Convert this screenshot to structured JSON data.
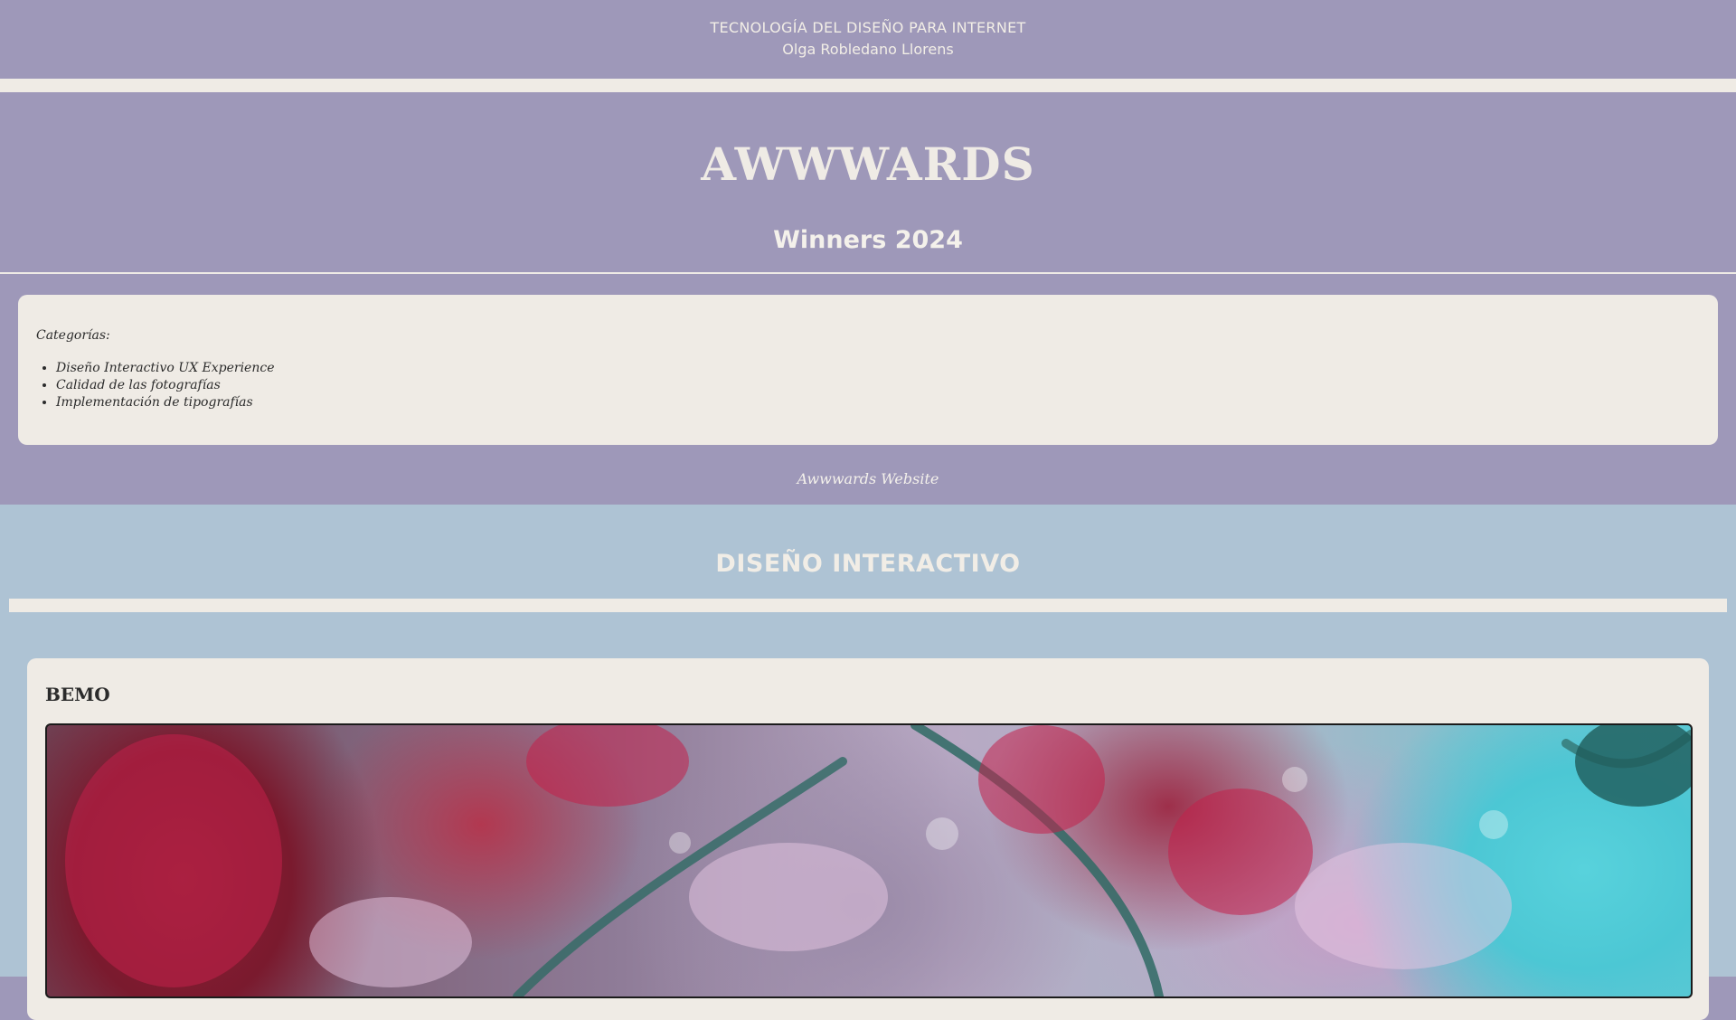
{
  "topbar": {
    "course": "TECNOLOGÍA DEL DISEÑO PARA INTERNET",
    "author": "Olga Robledano Llorens"
  },
  "hero": {
    "title": "AWWWARDS",
    "subtitle": "Winners 2024",
    "website_link": "Awwwards Website"
  },
  "categories": {
    "label": "Categorías:",
    "items": [
      "Diseño Interactivo UX Experience",
      "Calidad de las fotografías",
      "Implementación de tipografías"
    ]
  },
  "section": {
    "heading": "DISEÑO INTERACTIVO",
    "project": {
      "name": "BEMO",
      "image_icon": "floral-collage-image"
    }
  },
  "colors": {
    "lavender": "#9e98b9",
    "cream": "#efebe5",
    "blue": "#aec3d4",
    "text_dark": "#2b2b2b"
  }
}
